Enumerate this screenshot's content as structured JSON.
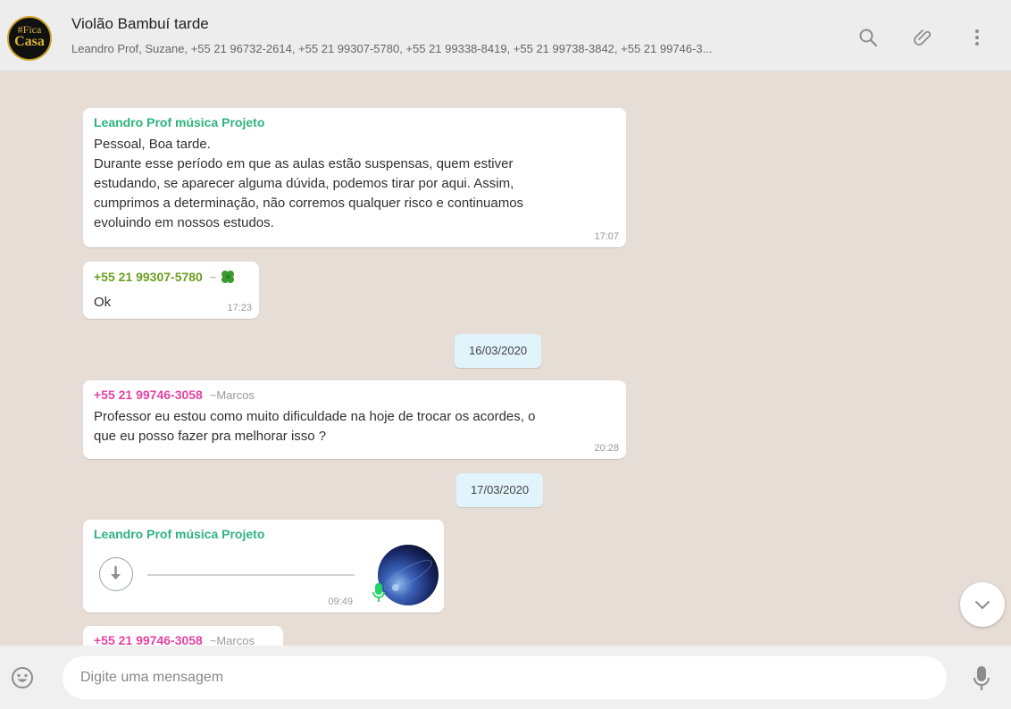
{
  "header": {
    "avatar_text_line1": "#Fica",
    "avatar_text_line2": "Casa",
    "title": "Violão Bambuí tarde",
    "participants": "Leandro Prof, Suzane, +55 21 96732-2614, +55 21 99307-5780, +55 21 99338-8419, +55 21 99738-3842, +55 21 99746-3..."
  },
  "messages": [
    {
      "sender": "Leandro Prof música Projeto",
      "sender_color": "#2eb37e",
      "text_lines": [
        "Pessoal, Boa tarde.",
        "Durante esse período em que as aulas estão suspensas, quem estiver",
        "estudando,  se aparecer alguma dúvida, podemos tirar por aqui. Assim,",
        "cumprimos a determinação, não corremos qualquer risco e continuamos",
        "evoluindo em nossos estudos."
      ],
      "time": "17:07"
    },
    {
      "sender": "+55 21 99307-5780",
      "sender_color": "#6b9e1f",
      "alias": "~",
      "alias_icon": "four-leaf-clover-icon",
      "text": "Ok",
      "time": "17:23"
    },
    {
      "sender": "+55 21 99746-3058",
      "sender_color": "#e542a3",
      "alias": "~Marcos",
      "text_lines": [
        "Professor eu estou como muito dificuldade na hoje de trocar os acordes, o",
        "que eu posso fazer pra melhorar isso ?"
      ],
      "time": "20:28"
    },
    {
      "sender": "Leandro Prof música Projeto",
      "sender_color": "#2eb37e",
      "type": "voice-message",
      "time": "09:49"
    },
    {
      "sender": "+55 21 99746-3058",
      "sender_color": "#e542a3",
      "alias": "~Marcos"
    }
  ],
  "dates": [
    "16/03/2020",
    "17/03/2020"
  ],
  "footer": {
    "placeholder": "Digite uma mensagem"
  },
  "colors": {
    "header_bg": "#ededed",
    "chat_bg": "#e6ded6",
    "date_bg": "#e1f3fb",
    "mic_green": "#25d366"
  }
}
